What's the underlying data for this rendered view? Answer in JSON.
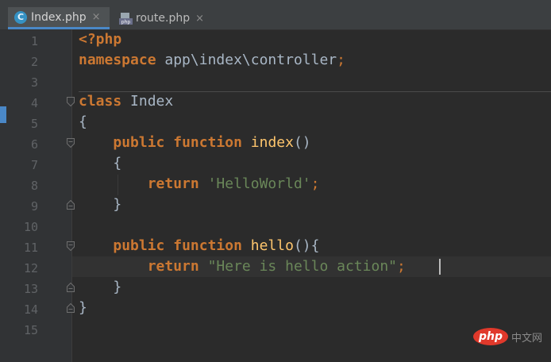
{
  "tabs": [
    {
      "label": "Index.php",
      "icon": "php-class-icon",
      "active": true
    },
    {
      "label": "route.php",
      "icon": "php-file-icon",
      "active": false
    }
  ],
  "tab_close_glyph": "×",
  "line_numbers": [
    "1",
    "2",
    "3",
    "4",
    "5",
    "6",
    "7",
    "8",
    "9",
    "10",
    "11",
    "12",
    "13",
    "14",
    "15"
  ],
  "code": {
    "l1": {
      "tag": "<?php"
    },
    "l2": {
      "kw": "namespace",
      "text": " app\\index\\controller",
      "semi": ";"
    },
    "l4": {
      "kw": "class",
      "text": " Index"
    },
    "l5": {
      "text": "{"
    },
    "l6": {
      "kw1": "public",
      "kw2": "function",
      "fn": "index",
      "text": "()"
    },
    "l7": {
      "text": "{"
    },
    "l8": {
      "kw": "return",
      "str": "'HelloWorld'",
      "semi": ";"
    },
    "l9": {
      "text": "}"
    },
    "l11": {
      "kw1": "public",
      "kw2": "function",
      "fn": "hello",
      "text": "(){"
    },
    "l12": {
      "kw": "return",
      "str": "\"Here is hello action\"",
      "semi": ";"
    },
    "l13": {
      "text": "}"
    },
    "l14": {
      "text": "}"
    }
  },
  "watermark": {
    "badge": "php",
    "text": "中文网"
  },
  "colors": {
    "background": "#2b2b2b",
    "keyword": "#cc7832",
    "string": "#6a8759",
    "function": "#ffc66d",
    "text": "#a9b7c6",
    "line_number": "#606366",
    "accent": "#4a88c7"
  }
}
